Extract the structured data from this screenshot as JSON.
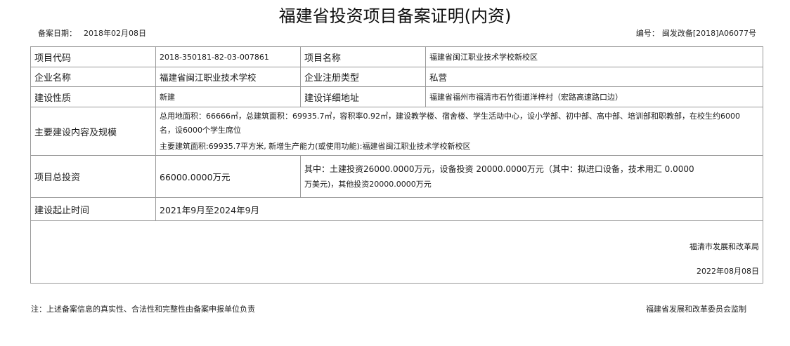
{
  "document": {
    "title": "福建省投资项目备案证明(内资)",
    "filing_date_label": "备案日期：",
    "filing_date": "2018年02月08日",
    "number_label": "编号：",
    "number": "闽发改备[2018]A06077号"
  },
  "form": {
    "project_code_label": "项目代码",
    "project_code": "2018-350181-82-03-007861",
    "project_name_label": "项目名称",
    "project_name": "福建省闽江职业技术学校新校区",
    "company_name_label": "企业名称",
    "company_name": "福建省闽江职业技术学校",
    "company_type_label": "企业注册类型",
    "company_type": "私营",
    "construction_nature_label": "建设性质",
    "construction_nature": "新建",
    "address_label": "建设详细地址",
    "address": "福建省福州市福清市石竹街道洋梓村（宏路高速路口边）",
    "scale_label": "主要建设内容及规模",
    "scale_line1": "总用地面积：66666㎡，总建筑面积：69935.7㎡，容积率0.92㎡，建设教学楼、宿舍楼、学生活动中心，设小学部、初中部、高中部、培训部和职教部，在校生约6000",
    "scale_line1b": "名，设6000个学生席位",
    "scale_line2": "主要建筑面积:69935.7平方米, 新增生产能力(或使用功能):福建省闽江职业技术学校新校区",
    "total_investment_label": "项目总投资",
    "total_investment": "66000.0000万元",
    "investment_detail_line1": "其中：土建投资26000.0000万元，设备投资 20000.0000万元（其中：拟进口设备，技术用汇 0.0000",
    "investment_detail_line2": "万美元)，其他投资20000.0000万元",
    "period_label": "建设起止时间",
    "period": "2021年9月至2024年9月",
    "signing_org": "福清市发展和改革局",
    "signing_date": "2022年08月08日"
  },
  "footer": {
    "note": "注：上述备案信息的真实性、合法性和完整性由备案申报单位负责",
    "supervisor": "福建省发展和改革委员会监制"
  }
}
